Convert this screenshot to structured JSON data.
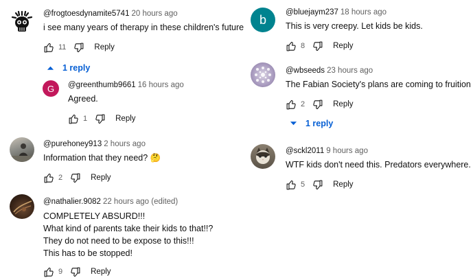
{
  "colors": {
    "link_blue": "#065fd4",
    "meta_gray": "#606060"
  },
  "left_comments": [
    {
      "author": "@frogtoesdynamite5741",
      "time": "20 hours ago",
      "text": "i see many years of therapy in these children's future",
      "likes": "11",
      "reply_label": "Reply",
      "replies_toggle": "1 reply",
      "replies": [
        {
          "avatar_letter": "G",
          "author": "@greenthumb9661",
          "time": "16 hours ago",
          "text": "Agreed.",
          "likes": "1",
          "reply_label": "Reply"
        }
      ]
    },
    {
      "author": "@purehoney913",
      "time": "2 hours ago",
      "text": "Information that they need? 🤔",
      "likes": "2",
      "reply_label": "Reply"
    },
    {
      "author": "@nathalier.9082",
      "time": "22 hours ago (edited)",
      "text_lines": [
        "COMPLETELY ABSURD!!!",
        "What kind of parents take their kids to that!!?",
        "They do not need to be expose to this!!!",
        "This has to be stopped!"
      ],
      "likes": "9",
      "reply_label": "Reply"
    }
  ],
  "right_comments": [
    {
      "avatar_letter": "b",
      "author": "@bluejaym237",
      "time": "18 hours ago",
      "text": "This is very creepy.  Let kids be kids.",
      "likes": "8",
      "reply_label": "Reply"
    },
    {
      "author": "@wbseeds",
      "time": "23 hours ago",
      "text": "The Fabian Society's plans are coming to fruition",
      "likes": "2",
      "reply_label": "Reply",
      "replies_toggle": "1 reply"
    },
    {
      "author": "@sckl2011",
      "time": "9 hours ago",
      "text": "WTF kids don't need this. Predators everywhere.",
      "likes": "5",
      "reply_label": "Reply"
    }
  ]
}
